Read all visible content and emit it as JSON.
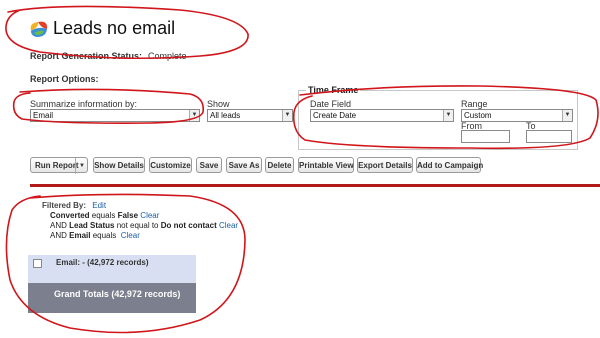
{
  "header": {
    "title": "Leads no email",
    "logo_icon": "cloud-logo-icon"
  },
  "status": {
    "label": "Report Generation Status:",
    "value": "Complete"
  },
  "options": {
    "section_label": "Report Options:",
    "summarize_label": "Summarize information by:",
    "summarize_value": "Email",
    "show_label": "Show",
    "show_value": "All leads",
    "timeframe": {
      "legend": "Time Frame",
      "date_field_label": "Date Field",
      "date_field_value": "Create Date",
      "range_label": "Range",
      "range_value": "Custom",
      "from_label": "From",
      "to_label": "To",
      "from_value": "",
      "to_value": ""
    }
  },
  "toolbar": {
    "run_report": "Run Report",
    "show_details": "Show Details",
    "customize": "Customize",
    "save": "Save",
    "save_as": "Save As",
    "delete": "Delete",
    "printable_view": "Printable View",
    "export_details": "Export Details",
    "add_to_campaign": "Add to Campaign"
  },
  "filters": {
    "label": "Filtered By:",
    "edit": "Edit",
    "f1_field": "Converted",
    "f1_op": " equals ",
    "f1_value": "False",
    "f2_prefix": "AND ",
    "f2_field": "Lead Status",
    "f2_op": " not equal to ",
    "f2_value": "Do not contact",
    "f3_prefix": "AND ",
    "f3_field": "Email",
    "f3_op": " equals ",
    "clear": "Clear"
  },
  "results": {
    "group_label": "Email: - (42,972 records)",
    "grand_total": "Grand Totals (42,972 records)"
  },
  "colors": {
    "annotation_red": "#d0161b",
    "accent_red": "#b11a1a",
    "group_bg": "#d8dff2",
    "grand_bg": "#7c7f8d"
  }
}
